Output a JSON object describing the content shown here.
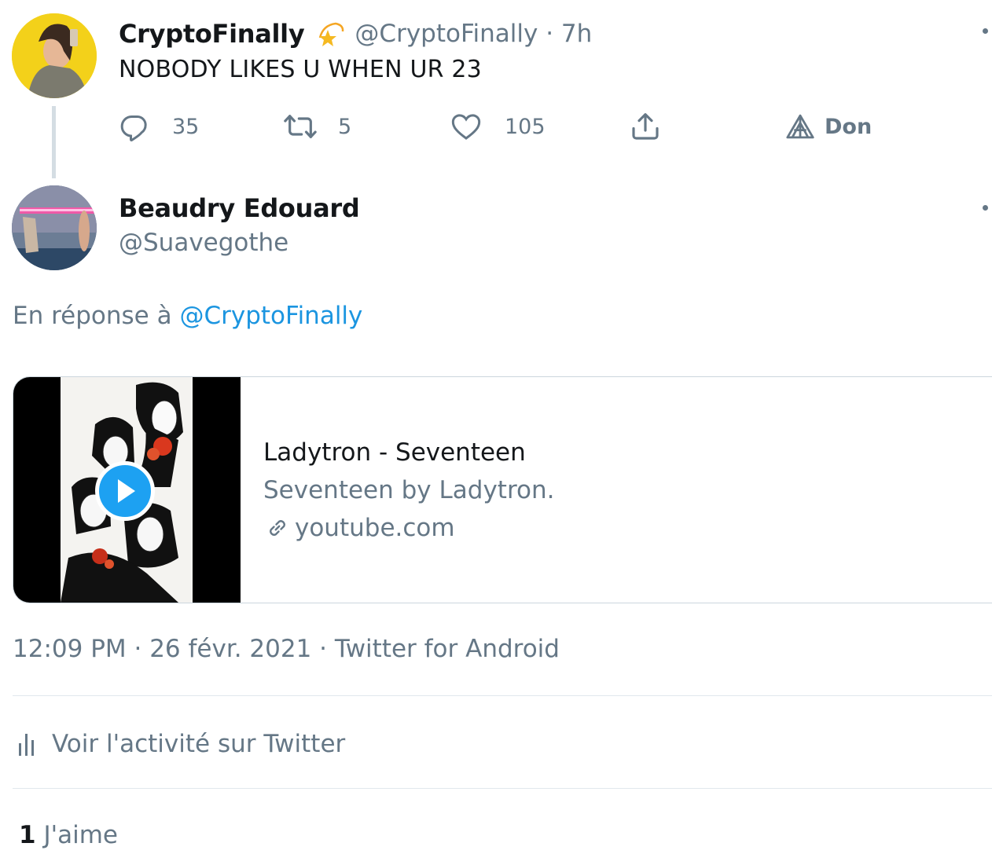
{
  "tweet1": {
    "display_name": "CryptoFinally",
    "badge_emoji": "💫",
    "handle_time": "@CryptoFinally · 7h",
    "text": "NOBODY LIKES U WHEN UR 23",
    "actions": {
      "reply_count": "35",
      "retweet_count": "5",
      "like_count": "105",
      "tip_label": "Don"
    }
  },
  "tweet2": {
    "display_name": "Beaudry Edouard",
    "handle": "@Suavegothe",
    "reply_prefix": "En réponse à",
    "reply_to": "@CryptoFinally",
    "card": {
      "title": "Ladytron - Seventeen",
      "description": "Seventeen by Ladytron.",
      "domain": "youtube.com"
    },
    "meta": "12:09 PM · 26 févr. 2021 · Twitter for Android",
    "activity_label": "Voir l'activité sur Twitter",
    "likes_count": "1",
    "likes_label": "J'aime"
  },
  "icons": {
    "reply": "reply-icon",
    "retweet": "retweet-icon",
    "like": "heart-icon",
    "share": "share-icon",
    "tip": "tip-icon",
    "more": "more-icon",
    "link": "link-icon",
    "analytics": "analytics-icon",
    "play": "play-icon"
  },
  "colors": {
    "text": "#14171a",
    "muted": "#657786",
    "link": "#1b95e0",
    "play": "#1da1f2",
    "divider": "#e1e8ed"
  }
}
